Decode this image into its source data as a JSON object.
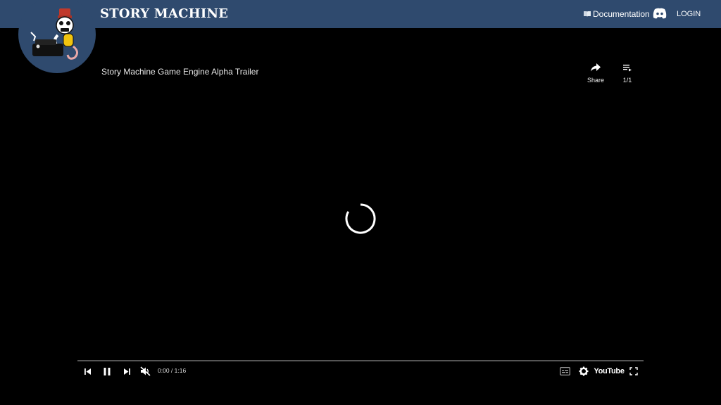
{
  "header": {
    "brand": "STORY MACHINE",
    "nav": {
      "documentation": "Documentation",
      "login": "LOGIN"
    }
  },
  "video": {
    "title": "Story Machine Game Engine Alpha Trailer",
    "share_label": "Share",
    "playlist_label": "1/1",
    "time_display": "0:00 / 1:16",
    "youtube_wordmark": "YouTube"
  },
  "colors": {
    "header_bg": "#2f4a6e",
    "player_bg": "#000000"
  }
}
